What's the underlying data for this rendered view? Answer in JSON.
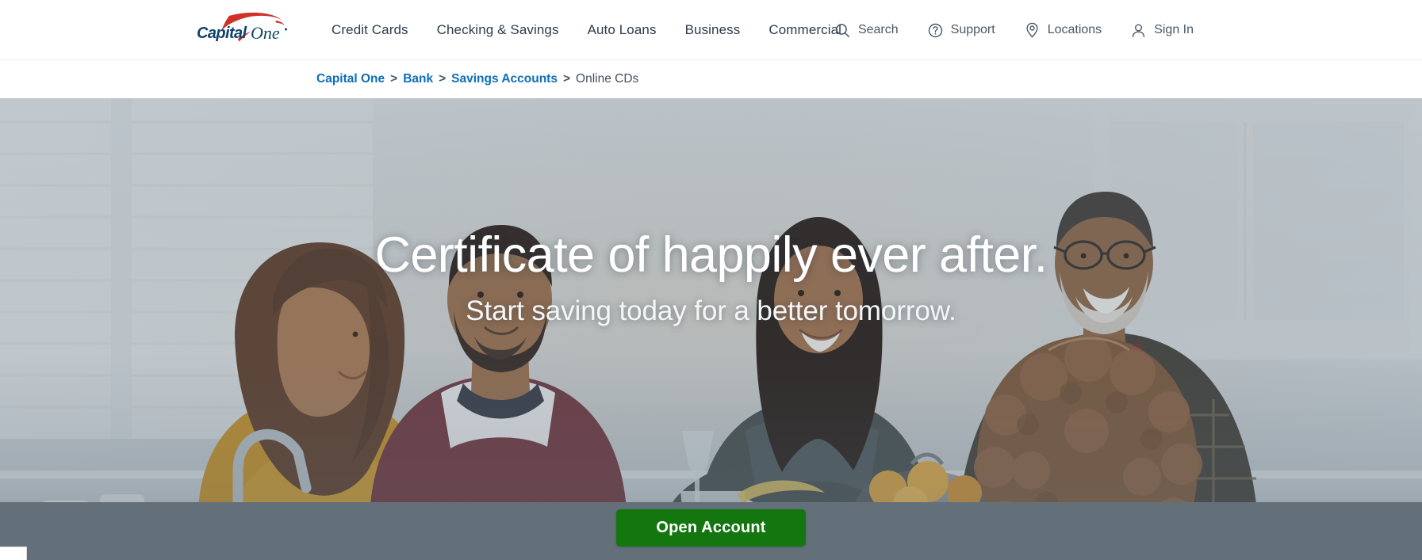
{
  "brand": {
    "logo_text_primary": "Capital",
    "logo_text_secondary": "One",
    "logo_name": "Capital One",
    "navy": "#10436e",
    "red": "#d03027",
    "link_blue": "#0d6eb8",
    "cta_green": "#14760f",
    "overlay_slate": "#63707a"
  },
  "header": {
    "nav": [
      {
        "label": "Credit Cards"
      },
      {
        "label": "Checking & Savings"
      },
      {
        "label": "Auto Loans"
      },
      {
        "label": "Business"
      },
      {
        "label": "Commercial"
      }
    ],
    "utility": [
      {
        "label": "Search",
        "icon": "search-icon"
      },
      {
        "label": "Support",
        "icon": "question-circle-icon"
      },
      {
        "label": "Locations",
        "icon": "map-pin-icon"
      },
      {
        "label": "Sign In",
        "icon": "person-icon"
      }
    ]
  },
  "breadcrumb": {
    "separator": ">",
    "items": [
      {
        "label": "Capital One",
        "current": false
      },
      {
        "label": "Bank",
        "current": false
      },
      {
        "label": "Savings Accounts",
        "current": false
      },
      {
        "label": "Online CDs",
        "current": true
      }
    ]
  },
  "hero": {
    "title": "Certificate of happily ever after.",
    "subtitle": "Start saving today for a better tomorrow.",
    "cta_label": "Open Account",
    "image_alt": "Multi-generational family smiling together around a kitchen counter"
  }
}
